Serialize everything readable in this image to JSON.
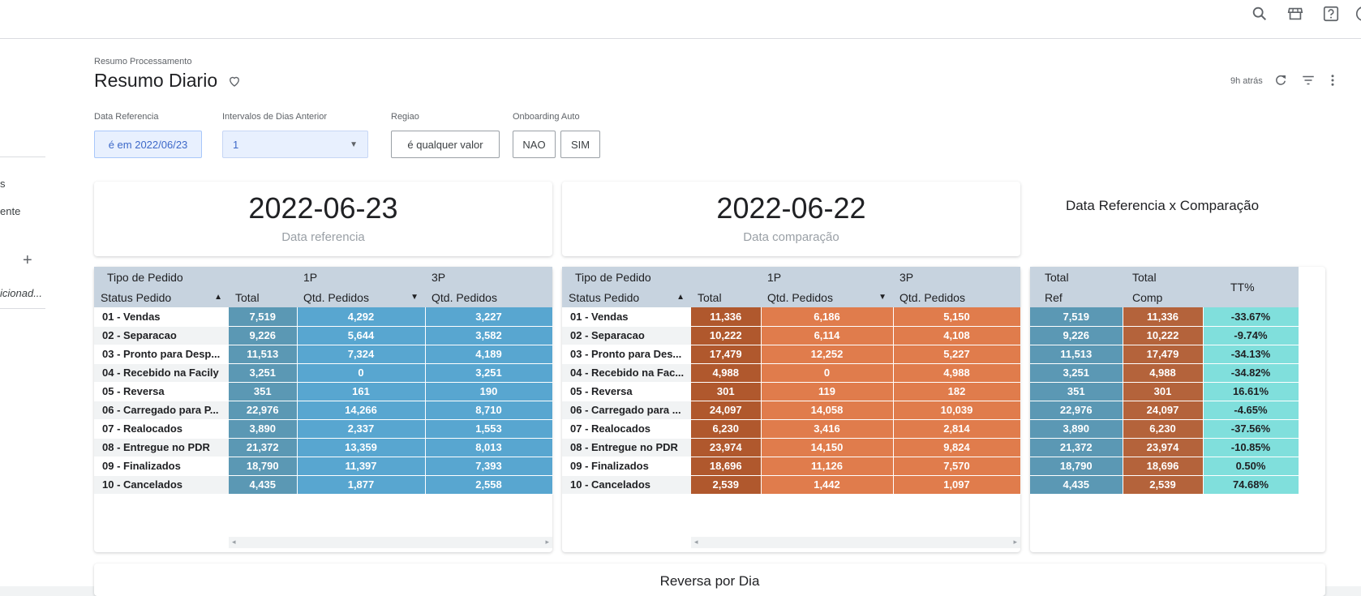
{
  "breadcrumb": "Resumo Processamento",
  "title": "Resumo Diario",
  "updated": "9h atrás",
  "sidebar": {
    "item1": "s",
    "item2": "ente",
    "item3": "icionad..."
  },
  "filters": {
    "data_ref_label": "Data Referencia",
    "data_ref_value": "é em 2022/06/23",
    "intervalo_label": "Intervalos de Dias Anterior",
    "intervalo_value": "1",
    "regiao_label": "Regiao",
    "regiao_value": "é qualquer valor",
    "onboarding_label": "Onboarding Auto",
    "onboarding_nao": "NAO",
    "onboarding_sim": "SIM"
  },
  "scorecards": {
    "ref_value": "2022-06-23",
    "ref_label": "Data referencia",
    "comp_value": "2022-06-22",
    "comp_label": "Data comparação",
    "cmp_title": "Data Referencia x Comparação"
  },
  "table_headers": {
    "tipo": "Tipo de Pedido",
    "status": "Status Pedido",
    "onep": "1P",
    "threep": "3P",
    "total": "Total",
    "qtd": "Qtd. Pedidos",
    "total_ref_1": "Total",
    "total_ref_2": "Ref",
    "total_comp_1": "Total",
    "total_comp_2": "Comp",
    "tt": "TT%"
  },
  "ref_rows": [
    [
      "01 - Vendas",
      "7,519",
      "4,292",
      "3,227"
    ],
    [
      "02 - Separacao",
      "9,226",
      "5,644",
      "3,582"
    ],
    [
      "03 - Pronto para Desp...",
      "11,513",
      "7,324",
      "4,189"
    ],
    [
      "04 - Recebido na Facily",
      "3,251",
      "0",
      "3,251"
    ],
    [
      "05 - Reversa",
      "351",
      "161",
      "190"
    ],
    [
      "06 - Carregado para P...",
      "22,976",
      "14,266",
      "8,710"
    ],
    [
      "07 - Realocados",
      "3,890",
      "2,337",
      "1,553"
    ],
    [
      "08 - Entregue no PDR",
      "21,372",
      "13,359",
      "8,013"
    ],
    [
      "09 - Finalizados",
      "18,790",
      "11,397",
      "7,393"
    ],
    [
      "10 - Cancelados",
      "4,435",
      "1,877",
      "2,558"
    ]
  ],
  "comp_rows": [
    [
      "01 - Vendas",
      "11,336",
      "6,186",
      "5,150"
    ],
    [
      "02 - Separacao",
      "10,222",
      "6,114",
      "4,108"
    ],
    [
      "03 - Pronto para Des...",
      "17,479",
      "12,252",
      "5,227"
    ],
    [
      "04 - Recebido na Fac...",
      "4,988",
      "0",
      "4,988"
    ],
    [
      "05 - Reversa",
      "301",
      "119",
      "182"
    ],
    [
      "06 - Carregado para ...",
      "24,097",
      "14,058",
      "10,039"
    ],
    [
      "07 - Realocados",
      "6,230",
      "3,416",
      "2,814"
    ],
    [
      "08 - Entregue no PDR",
      "23,974",
      "14,150",
      "9,824"
    ],
    [
      "09 - Finalizados",
      "18,696",
      "11,126",
      "7,570"
    ],
    [
      "10 - Cancelados",
      "2,539",
      "1,442",
      "1,097"
    ]
  ],
  "cmp_rows": [
    [
      "7,519",
      "11,336",
      "-33.67%"
    ],
    [
      "9,226",
      "10,222",
      "-9.74%"
    ],
    [
      "11,513",
      "17,479",
      "-34.13%"
    ],
    [
      "3,251",
      "4,988",
      "-34.82%"
    ],
    [
      "351",
      "301",
      "16.61%"
    ],
    [
      "22,976",
      "24,097",
      "-4.65%"
    ],
    [
      "3,890",
      "6,230",
      "-37.56%"
    ],
    [
      "21,372",
      "23,974",
      "-10.85%"
    ],
    [
      "18,790",
      "18,696",
      "0.50%"
    ],
    [
      "4,435",
      "2,539",
      "74.68%"
    ]
  ],
  "bottom_title": "Reversa por Dia"
}
